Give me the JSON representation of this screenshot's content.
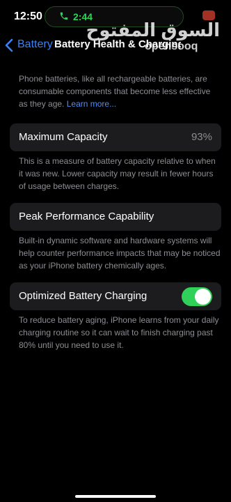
{
  "status_bar": {
    "time": "12:50",
    "call_duration": "2:44",
    "call_color": "#30d158"
  },
  "watermark": {
    "arabic": "السوق المفتوح",
    "latin": "opensooq"
  },
  "nav": {
    "back_label": "Battery",
    "title": "Battery Health & Charging",
    "accent_color": "#3b82f6"
  },
  "intro": {
    "text": "Phone batteries, like all rechargeable batteries, are consumable components that become less effective as they age.",
    "link_text": "Learn more..."
  },
  "maximum_capacity": {
    "label": "Maximum Capacity",
    "value": "93%",
    "footer": "This is a measure of battery capacity relative to when it was new. Lower capacity may result in fewer hours of usage between charges."
  },
  "peak_performance": {
    "label": "Peak Performance Capability",
    "footer": "Built-in dynamic software and hardware systems will help counter performance impacts that may be noticed as your iPhone battery chemically ages."
  },
  "optimized_charging": {
    "label": "Optimized Battery Charging",
    "enabled": true,
    "toggle_color": "#30d158",
    "footer": "To reduce battery aging, iPhone learns from your daily charging routine so it can wait to finish charging past 80% until you need to use it."
  },
  "icons": {
    "back": "chevron-left-icon",
    "call": "phone-icon"
  }
}
